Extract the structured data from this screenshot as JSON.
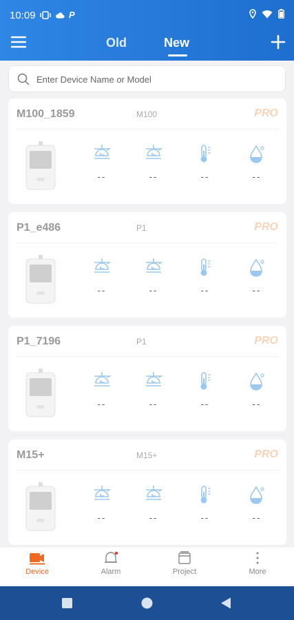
{
  "status_bar": {
    "time": "10:09",
    "p_label": "P"
  },
  "header": {
    "tabs": [
      {
        "label": "Old"
      },
      {
        "label": "New"
      }
    ],
    "active_tab": "New"
  },
  "search": {
    "placeholder": "Enter Device Name or Model"
  },
  "devices": [
    {
      "name": "M100_1859",
      "model": "M100",
      "badge": "PRO",
      "readings": [
        "--",
        "--",
        "--",
        "--"
      ]
    },
    {
      "name": "P1_e486",
      "model": "P1",
      "badge": "PRO",
      "readings": [
        "--",
        "--",
        "--",
        "--"
      ]
    },
    {
      "name": "P1_7196",
      "model": "P1",
      "badge": "PRO",
      "readings": [
        "--",
        "--",
        "--",
        "--"
      ]
    },
    {
      "name": "M15+",
      "model": "M15+",
      "badge": "PRO",
      "readings": [
        "--",
        "--",
        "--",
        "--"
      ]
    }
  ],
  "sensor_icons": [
    "scale-pm-icon",
    "scale-pm-icon",
    "thermometer-icon",
    "humidity-drop-icon"
  ],
  "bottom_nav": [
    {
      "label": "Device",
      "icon": "device-icon",
      "active": true
    },
    {
      "label": "Alarm",
      "icon": "alarm-bell-icon",
      "active": false
    },
    {
      "label": "Project",
      "icon": "project-icon",
      "active": false
    },
    {
      "label": "More",
      "icon": "more-vertical-icon",
      "active": false
    }
  ],
  "colors": {
    "header": "#2f86e4",
    "accent": "#f06a22",
    "pro": "#f8d3b8",
    "icon": "#9cc8ef",
    "system_nav": "#1c4f94"
  }
}
